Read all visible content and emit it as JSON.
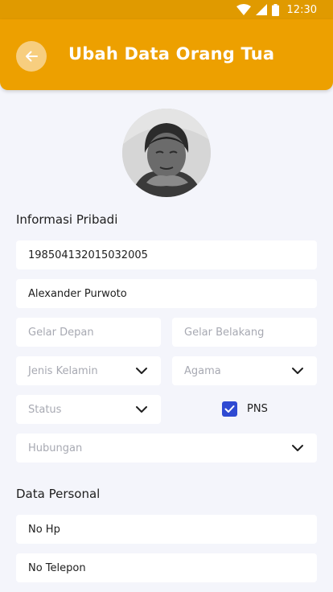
{
  "status_bar": {
    "time": "12:30"
  },
  "header": {
    "title": "Ubah Data Orang Tua"
  },
  "sections": {
    "personal_info": "Informasi Pribadi",
    "personal_data": "Data Personal"
  },
  "form": {
    "nip": {
      "value": "198504132015032005"
    },
    "nama": {
      "value": "Alexander Purwoto"
    },
    "gelar_depan": {
      "placeholder": "Gelar Depan"
    },
    "gelar_belakang": {
      "placeholder": "Gelar Belakang"
    },
    "jenis_kelamin": {
      "placeholder": "Jenis Kelamin"
    },
    "agama": {
      "placeholder": "Agama"
    },
    "status": {
      "placeholder": "Status"
    },
    "pns": {
      "label": "PNS",
      "checked": true
    },
    "hubungan": {
      "placeholder": "Hubungan"
    },
    "no_hp": {
      "value": "No Hp"
    },
    "no_telepon": {
      "value": "No Telepon"
    }
  },
  "colors": {
    "primary": "#eda000",
    "status_bar": "#e09a00",
    "checkbox": "#2f4ad2",
    "background": "#f4f5fb"
  }
}
